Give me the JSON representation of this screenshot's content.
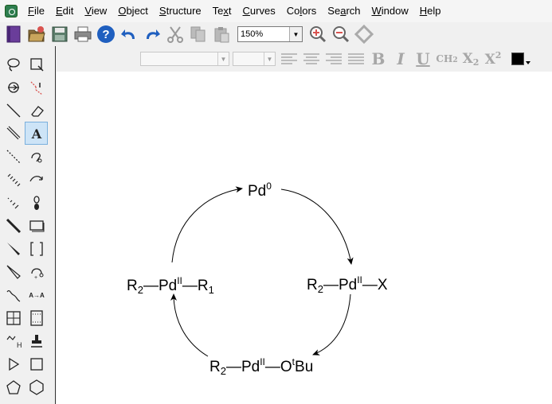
{
  "menubar": {
    "items": [
      {
        "label": "File",
        "key": "F"
      },
      {
        "label": "Edit",
        "key": "E"
      },
      {
        "label": "View",
        "key": "V"
      },
      {
        "label": "Object",
        "key": "O"
      },
      {
        "label": "Structure",
        "key": "S"
      },
      {
        "label": "Text",
        "key": "x"
      },
      {
        "label": "Curves",
        "key": "C"
      },
      {
        "label": "Colors",
        "key": "l"
      },
      {
        "label": "Search",
        "key": "a"
      },
      {
        "label": "Window",
        "key": "W"
      },
      {
        "label": "Help",
        "key": "H"
      }
    ]
  },
  "toolbar": {
    "zoom_value": "150%"
  },
  "format_toolbar": {
    "bold": "B",
    "italic": "I",
    "underline": "U",
    "formula": "CH2",
    "subscript": "X2",
    "superscript": "X2",
    "text_color": "#000000"
  },
  "palette_tools": [
    "lasso-tool-icon",
    "marquee-tool-icon",
    "structure-perspective-icon",
    "bond-tool-icon",
    "solid-bond-icon",
    "eraser-icon",
    "bold-bond-icon",
    "text-tool-icon",
    "dashed-bond-icon",
    "pen-tool-icon",
    "hashed-bond-icon",
    "arrow-tool-icon",
    "hashed-wedge-icon",
    "orbital-tool-icon",
    "bold-line-icon",
    "drawing-elements-icon",
    "wedge-bond-icon",
    "brackets-icon",
    "hollow-wedge-icon",
    "chemical-symbols-icon",
    "wavy-bond-icon",
    "atom-mapping-icon",
    "table-tool-icon",
    "tlc-plate-icon",
    "query-tool-icon",
    "stamp-tool-icon",
    "play-icon",
    "rectangle-icon",
    "pentagon-icon",
    "hexagon-icon"
  ],
  "diagram": {
    "top": {
      "base": "Pd",
      "sup": "0"
    },
    "right": {
      "pre": "R",
      "sub": "2",
      "mid": "—Pd",
      "sup": "II",
      "post": "—X"
    },
    "bottom": {
      "pre": "R",
      "sub": "2",
      "mid": "—Pd",
      "sup": "II",
      "mid2": "—O",
      "sup2": "t",
      "post": "Bu"
    },
    "left": {
      "pre": "R",
      "sub": "2",
      "mid": "—Pd",
      "sup": "II",
      "mid2": "—R",
      "sub2": "1"
    }
  }
}
